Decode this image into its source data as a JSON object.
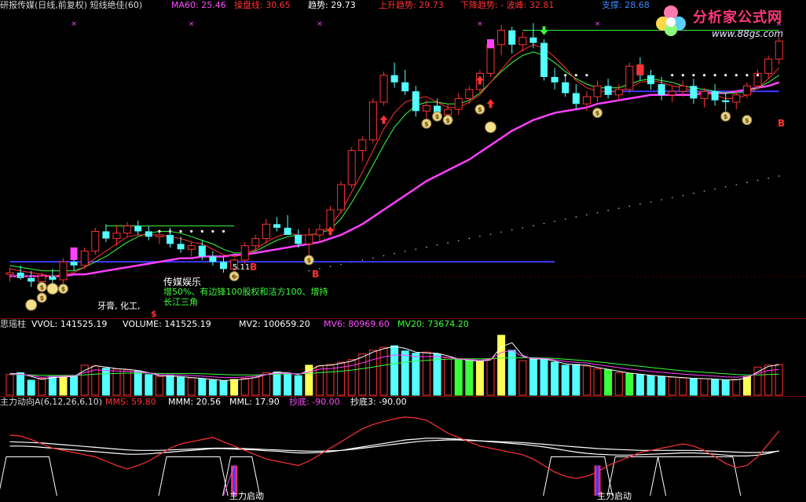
{
  "main_header": {
    "title": "研报传媒(日线,前复权) 短线绝佳(60)",
    "ma60": "MA60: 25.46",
    "tuopan": "操盘线: 30.65",
    "trend": "趋势: 29.73",
    "rising_trend": "上升趋势: 29.73",
    "falling_trend": "下降趋势: - 波峰: 32.81",
    "support": "支撑: 28.68"
  },
  "logo": {
    "name": "分析家公式网",
    "url": "www.88gs.com"
  },
  "annotations": {
    "sector": "传媒娱乐",
    "note_prefix": "增50%、",
    "note": "有边锋100股权和洁方100、增持",
    "note2": "长江三角",
    "note3": "牙膏, 化工,",
    "price_tag": "5.11",
    "s_mark": "$",
    "b_mark": "B"
  },
  "vol_header": {
    "title": "思瑶柱",
    "vvol": "VVOL: 141525.19",
    "volume": "VOLUME: 141525.19",
    "mv2": "MV2: 100659.20",
    "mv6": "MV6: 80969.60",
    "mv20": "MV20: 73674.20"
  },
  "ind_header": {
    "title": "主力动向A(6,12,26,6,10)",
    "mms": "MMS: 59.80",
    "mmm": "MMM: 20.56",
    "mml": "MML: 17.90",
    "chaodi": "抄底: -90.00",
    "chaodi3": "抄底3: -90.00",
    "launch": "主力启动"
  },
  "colors": {
    "up": "#ff3232",
    "down": "#54ffff",
    "ma_magenta": "#ff40ff",
    "ma_red": "#ff3232",
    "ma_green": "#3cff3c",
    "support_blue": "#3c3cff",
    "yellow": "#ffff54"
  },
  "chart_data": [
    {
      "type": "candlestick",
      "ylim": [
        16.8,
        33.3
      ],
      "ohlc": [
        [
          18.8,
          19.2,
          18.4,
          18.9
        ],
        [
          18.9,
          19.3,
          18.5,
          18.6
        ],
        [
          18.6,
          19.0,
          18.1,
          18.4
        ],
        [
          18.4,
          18.9,
          18.2,
          18.7
        ],
        [
          18.7,
          19.1,
          18.3,
          18.5
        ],
        [
          18.5,
          19.7,
          18.3,
          19.5
        ],
        [
          19.5,
          20.0,
          19.0,
          19.3
        ],
        [
          19.3,
          20.3,
          19.1,
          20.1
        ],
        [
          20.1,
          21.4,
          19.9,
          21.2
        ],
        [
          21.2,
          21.6,
          20.6,
          20.8
        ],
        [
          20.8,
          21.5,
          20.4,
          21.1
        ],
        [
          21.1,
          21.7,
          20.9,
          21.5
        ],
        [
          21.5,
          21.8,
          21.0,
          21.2
        ],
        [
          21.2,
          21.5,
          20.7,
          20.9
        ],
        [
          20.9,
          21.3,
          20.5,
          21.0
        ],
        [
          21.0,
          21.4,
          20.3,
          20.5
        ],
        [
          20.5,
          20.9,
          20.0,
          20.2
        ],
        [
          20.2,
          20.6,
          19.8,
          20.4
        ],
        [
          20.4,
          20.7,
          19.6,
          19.8
        ],
        [
          19.8,
          20.1,
          19.3,
          19.5
        ],
        [
          19.5,
          19.8,
          18.9,
          19.1
        ],
        [
          19.1,
          19.7,
          18.7,
          19.6
        ],
        [
          19.6,
          20.6,
          19.4,
          20.4
        ],
        [
          20.4,
          21.0,
          20.1,
          20.8
        ],
        [
          20.8,
          21.9,
          20.5,
          21.6
        ],
        [
          21.6,
          22.0,
          21.2,
          21.4
        ],
        [
          21.4,
          22.1,
          21.0,
          21.0
        ],
        [
          21.0,
          21.3,
          20.3,
          20.5
        ],
        [
          20.5,
          21.4,
          19.9,
          21.0
        ],
        [
          21.0,
          21.6,
          20.6,
          21.3
        ],
        [
          21.3,
          22.6,
          21.1,
          22.4
        ],
        [
          22.4,
          24.0,
          22.2,
          23.8
        ],
        [
          23.8,
          25.9,
          23.6,
          25.7
        ],
        [
          25.7,
          26.5,
          25.1,
          26.3
        ],
        [
          26.3,
          28.6,
          26.1,
          28.4
        ],
        [
          28.4,
          30.1,
          28.2,
          29.9
        ],
        [
          29.9,
          30.6,
          29.2,
          29.5
        ],
        [
          29.5,
          30.2,
          28.8,
          29.0
        ],
        [
          29.0,
          29.3,
          27.6,
          27.9
        ],
        [
          27.9,
          28.5,
          27.5,
          28.2
        ],
        [
          28.2,
          28.6,
          27.4,
          27.7
        ],
        [
          27.7,
          28.3,
          27.3,
          28.0
        ],
        [
          28.0,
          28.9,
          27.7,
          28.6
        ],
        [
          28.6,
          29.3,
          28.3,
          29.1
        ],
        [
          29.1,
          30.2,
          28.9,
          30.0
        ],
        [
          30.0,
          31.8,
          29.8,
          31.6
        ],
        [
          31.6,
          32.7,
          31.0,
          32.4
        ],
        [
          32.4,
          32.6,
          31.1,
          31.6
        ],
        [
          31.6,
          32.3,
          31.2,
          32.0
        ],
        [
          32.0,
          32.8,
          31.4,
          31.7
        ],
        [
          31.7,
          31.9,
          29.6,
          29.8
        ],
        [
          29.8,
          30.3,
          29.1,
          29.5
        ],
        [
          29.5,
          29.9,
          28.7,
          28.9
        ],
        [
          28.9,
          29.4,
          28.0,
          28.3
        ],
        [
          28.3,
          29.0,
          27.9,
          28.7
        ],
        [
          28.7,
          29.6,
          28.4,
          29.3
        ],
        [
          29.3,
          29.7,
          28.6,
          28.8
        ],
        [
          28.8,
          29.4,
          28.5,
          29.1
        ],
        [
          29.1,
          30.6,
          28.9,
          30.4
        ],
        [
          30.4,
          30.9,
          29.6,
          29.9
        ],
        [
          29.9,
          30.2,
          29.1,
          29.4
        ],
        [
          29.4,
          29.8,
          28.5,
          28.8
        ],
        [
          28.8,
          29.3,
          28.4,
          29.0
        ],
        [
          29.0,
          29.6,
          28.7,
          29.3
        ],
        [
          29.3,
          29.7,
          28.3,
          28.6
        ],
        [
          28.6,
          29.2,
          28.1,
          29.0
        ],
        [
          29.0,
          29.4,
          28.2,
          28.5
        ],
        [
          28.5,
          28.9,
          27.9,
          28.4
        ],
        [
          28.4,
          29.0,
          28.0,
          28.8
        ],
        [
          28.8,
          29.5,
          28.6,
          29.3
        ],
        [
          29.3,
          30.2,
          29.1,
          30.0
        ],
        [
          30.0,
          31.0,
          29.7,
          30.8
        ],
        [
          30.8,
          32.0,
          30.5,
          31.8
        ]
      ],
      "ma_red": [
        19.1,
        19.0,
        18.9,
        18.8,
        18.7,
        18.8,
        18.9,
        19.2,
        19.7,
        20.1,
        20.5,
        20.9,
        21.0,
        21.0,
        21.0,
        20.9,
        20.8,
        20.6,
        20.5,
        20.2,
        19.9,
        19.8,
        19.9,
        20.2,
        20.6,
        20.9,
        21.1,
        21.0,
        21.0,
        21.1,
        21.5,
        22.3,
        23.4,
        24.5,
        25.7,
        26.9,
        27.8,
        28.4,
        28.6,
        28.7,
        28.4,
        28.1,
        28.1,
        28.4,
        28.8,
        29.5,
        30.2,
        30.9,
        31.3,
        31.6,
        31.4,
        30.9,
        30.3,
        29.6,
        29.2,
        29.0,
        29.0,
        29.0,
        29.2,
        29.5,
        29.6,
        29.5,
        29.3,
        29.2,
        29.0,
        28.9,
        28.8,
        28.6,
        28.6,
        28.8,
        29.2,
        29.7,
        30.3
      ],
      "ma_green": [
        19.3,
        19.2,
        19.1,
        19.0,
        19.0,
        19.0,
        19.0,
        19.2,
        19.5,
        19.8,
        20.2,
        20.6,
        20.9,
        21.1,
        21.2,
        21.2,
        21.1,
        20.9,
        20.7,
        20.5,
        20.2,
        20.0,
        20.0,
        20.1,
        20.4,
        20.7,
        20.9,
        21.0,
        21.0,
        21.1,
        21.3,
        21.9,
        22.8,
        23.8,
        24.9,
        26.0,
        27.0,
        27.7,
        28.2,
        28.4,
        28.4,
        28.3,
        28.3,
        28.5,
        28.9,
        29.5,
        30.1,
        30.6,
        31.0,
        31.2,
        31.0,
        30.6,
        30.1,
        29.7,
        29.4,
        29.2,
        29.2,
        29.2,
        29.4,
        29.6,
        29.7,
        29.6,
        29.5,
        29.3,
        29.2,
        29.1,
        29.0,
        28.9,
        28.9,
        29.0,
        29.2,
        29.5,
        29.9
      ],
      "ma_magenta": [
        18.7,
        18.7,
        18.7,
        18.7,
        18.7,
        18.7,
        18.8,
        18.8,
        18.9,
        19.0,
        19.1,
        19.2,
        19.3,
        19.4,
        19.5,
        19.6,
        19.7,
        19.7,
        19.8,
        19.8,
        19.8,
        19.9,
        19.9,
        20.0,
        20.1,
        20.2,
        20.3,
        20.4,
        20.5,
        20.6,
        20.8,
        21.0,
        21.3,
        21.6,
        22.0,
        22.4,
        22.8,
        23.2,
        23.6,
        24.0,
        24.3,
        24.6,
        24.9,
        25.2,
        25.6,
        26.0,
        26.4,
        26.8,
        27.1,
        27.4,
        27.6,
        27.8,
        27.9,
        28.0,
        28.1,
        28.3,
        28.4,
        28.5,
        28.6,
        28.7,
        28.8,
        28.8,
        28.8,
        28.8,
        28.8,
        28.9,
        28.9,
        28.9,
        29.0,
        29.1,
        29.2,
        29.3,
        29.5
      ],
      "support_line": 29.0,
      "resistance_line": 32.4
    },
    {
      "type": "bar",
      "title": "思瑶柱",
      "values": [
        55,
        60,
        40,
        45,
        50,
        48,
        52,
        80,
        78,
        72,
        70,
        68,
        65,
        55,
        50,
        52,
        48,
        46,
        44,
        40,
        38,
        42,
        45,
        50,
        60,
        62,
        58,
        52,
        80,
        78,
        82,
        88,
        95,
        110,
        120,
        128,
        132,
        118,
        112,
        115,
        110,
        100,
        95,
        92,
        90,
        98,
        160,
        120,
        92,
        100,
        95,
        88,
        80,
        82,
        78,
        70,
        68,
        60,
        58,
        55,
        52,
        50,
        48,
        46,
        45,
        44,
        42,
        40,
        42,
        50,
        75,
        80,
        82
      ],
      "mv2": [
        58,
        57,
        50,
        42,
        47,
        49,
        50,
        66,
        79,
        75,
        71,
        69,
        66,
        60,
        52,
        51,
        50,
        47,
        45,
        42,
        39,
        40,
        43,
        47,
        55,
        61,
        60,
        55,
        66,
        79,
        80,
        85,
        91,
        102,
        115,
        124,
        130,
        125,
        115,
        113,
        112,
        105,
        97,
        93,
        91,
        94,
        129,
        140,
        106,
        96,
        97,
        91,
        84,
        81,
        80,
        74,
        69,
        64,
        59,
        56,
        53,
        51,
        49,
        47,
        45,
        44,
        43,
        41,
        41,
        46,
        62,
        77,
        81
      ],
      "mv20": [
        55,
        55,
        54,
        53,
        53,
        53,
        53,
        54,
        56,
        57,
        58,
        59,
        59,
        59,
        58,
        58,
        58,
        58,
        57,
        56,
        55,
        54,
        54,
        54,
        55,
        56,
        57,
        57,
        58,
        60,
        62,
        64,
        67,
        71,
        75,
        80,
        84,
        88,
        91,
        93,
        95,
        96,
        97,
        97,
        97,
        97,
        99,
        100,
        100,
        100,
        99,
        98,
        96,
        94,
        92,
        89,
        86,
        83,
        80,
        77,
        74,
        71,
        68,
        65,
        63,
        61,
        59,
        57,
        55,
        54,
        54,
        55,
        56
      ]
    },
    {
      "type": "line",
      "title": "主力动向A(6,12,26,6,10)",
      "ylim": [
        -100,
        100
      ],
      "mms": [
        40,
        38,
        30,
        20,
        10,
        5,
        0,
        -5,
        -10,
        -20,
        -30,
        -38,
        -30,
        -20,
        -5,
        10,
        20,
        25,
        30,
        35,
        25,
        15,
        5,
        -5,
        -15,
        -20,
        -25,
        -30,
        -20,
        -5,
        10,
        25,
        40,
        55,
        65,
        72,
        78,
        82,
        80,
        75,
        60,
        45,
        35,
        25,
        15,
        10,
        5,
        0,
        -5,
        -15,
        -30,
        -45,
        -55,
        -60,
        -55,
        -45,
        -30,
        -20,
        -10,
        0,
        5,
        10,
        15,
        20,
        15,
        5,
        -10,
        -25,
        -35,
        -30,
        -10,
        20,
        50
      ],
      "mmm": [
        15,
        15,
        14,
        12,
        10,
        8,
        6,
        4,
        2,
        0,
        -2,
        -4,
        -4,
        -3,
        -1,
        1,
        3,
        5,
        7,
        9,
        9,
        8,
        7,
        6,
        4,
        3,
        1,
        -1,
        -1,
        0,
        2,
        5,
        9,
        13,
        17,
        21,
        25,
        29,
        31,
        33,
        33,
        32,
        31,
        29,
        27,
        25,
        23,
        21,
        19,
        16,
        13,
        9,
        5,
        1,
        -2,
        -4,
        -5,
        -6,
        -6,
        -5,
        -4,
        -3,
        -2,
        -1,
        -1,
        -2,
        -4,
        -6,
        -8,
        -8,
        -6,
        -2,
        4
      ],
      "mml": [
        25,
        24,
        23,
        22,
        20,
        18,
        16,
        14,
        12,
        10,
        8,
        6,
        5,
        5,
        5,
        6,
        7,
        8,
        9,
        10,
        10,
        10,
        9,
        8,
        7,
        6,
        5,
        4,
        3,
        3,
        4,
        5,
        7,
        10,
        13,
        16,
        19,
        22,
        25,
        27,
        28,
        29,
        29,
        28,
        27,
        26,
        25,
        24,
        23,
        21,
        19,
        17,
        15,
        13,
        11,
        9,
        8,
        7,
        6,
        5,
        5,
        5,
        5,
        5,
        5,
        4,
        3,
        2,
        1,
        0,
        0,
        1,
        3
      ],
      "chaodi_plateaus": [
        [
          0,
          3
        ],
        [
          15,
          19
        ],
        [
          21,
          22
        ],
        [
          51,
          55
        ],
        [
          57,
          60
        ],
        [
          61,
          67
        ]
      ]
    }
  ]
}
